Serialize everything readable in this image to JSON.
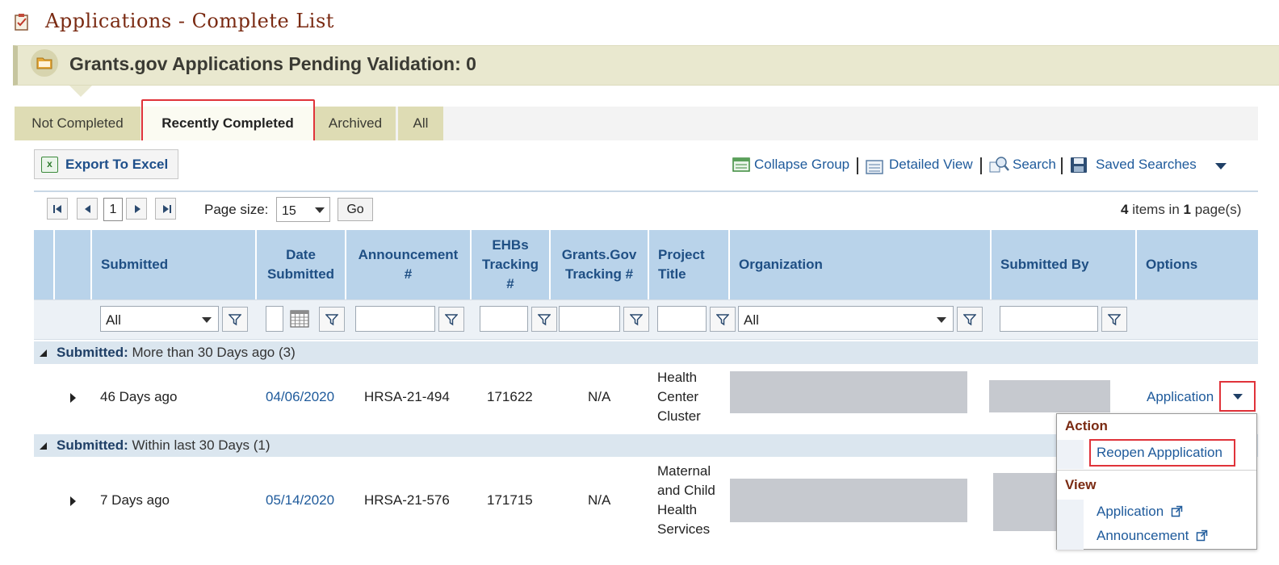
{
  "page": {
    "title": "Applications - Complete List",
    "title_icon": "clipboard-check-icon"
  },
  "pending": {
    "text": "Grants.gov Applications Pending Validation: 0",
    "icon": "folder-icon"
  },
  "tabs": [
    {
      "label": "Not Completed",
      "selected": false
    },
    {
      "label": "Recently Completed",
      "selected": true
    },
    {
      "label": "Archived",
      "selected": false
    },
    {
      "label": "All",
      "selected": false
    }
  ],
  "toolbar": {
    "export_label": "Export To Excel",
    "collapse_group": "Collapse Group",
    "detailed_view": "Detailed View",
    "search": "Search",
    "saved_searches": "Saved Searches",
    "separator": "|"
  },
  "pager": {
    "current_page": "1",
    "page_size_label": "Page size:",
    "page_size": "15",
    "go_label": "Go",
    "items_count": "4",
    "items_text": "items in",
    "pages_count": "1",
    "pages_text": "page(s)"
  },
  "columns": {
    "submitted": "Submitted",
    "date_submitted_1": "Date",
    "date_submitted_2": "Submitted",
    "announcement_1": "Announcement",
    "announcement_2": "#",
    "ehbs_1": "EHBs",
    "ehbs_2": "Tracking",
    "ehbs_3": "#",
    "grantsgov_1": "Grants.Gov",
    "grantsgov_2": "Tracking #",
    "project_1": "Project",
    "project_2": "Title",
    "organization": "Organization",
    "submitted_by": "Submitted By",
    "options": "Options"
  },
  "filters": {
    "submitted": "All",
    "organization": "All"
  },
  "groups": [
    {
      "label": "Submitted:",
      "value": "More than 30 Days ago (3)",
      "rows": [
        {
          "submitted": "46 Days ago",
          "date": "04/06/2020",
          "announcement": "HRSA-21-494",
          "ehbs": "171622",
          "grantsgov": "N/A",
          "project_lines": [
            "Health",
            "Center",
            "Cluster"
          ],
          "option": "Application"
        }
      ]
    },
    {
      "label": "Submitted:",
      "value": "Within last 30 Days (1)",
      "rows": [
        {
          "submitted": "7 Days ago",
          "date": "05/14/2020",
          "announcement": "HRSA-21-576",
          "ehbs": "171715",
          "grantsgov": "N/A",
          "project_lines": [
            "Maternal",
            "and Child",
            "Health",
            "Services"
          ]
        }
      ]
    }
  ],
  "context_menu": {
    "action_heading": "Action",
    "reopen": "Reopen Appplication",
    "view_heading": "View",
    "application": "Application",
    "announcement": "Announcement"
  },
  "colors": {
    "title": "#7a2a12",
    "link": "#1e5a9b",
    "header_bg": "#b9d3ea",
    "highlight": "#e0333a",
    "tab_bg": "#dedcb4"
  }
}
